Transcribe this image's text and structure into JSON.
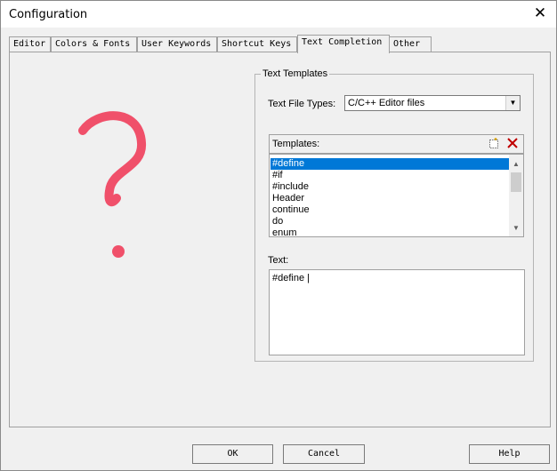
{
  "window": {
    "title": "Configuration",
    "close_glyph": "✕"
  },
  "tabs": [
    {
      "label": "Editor"
    },
    {
      "label": "Colors & Fonts"
    },
    {
      "label": "User Keywords"
    },
    {
      "label": "Shortcut Keys"
    },
    {
      "label": "Text Completion"
    },
    {
      "label": "Other"
    }
  ],
  "active_tab": "Text Completion",
  "text_templates": {
    "group_title": "Text Templates",
    "file_types_label": "Text File Types:",
    "file_types_value": "C/C++ Editor files",
    "templates_label": "Templates:",
    "templates": [
      "#define",
      "#if",
      "#include",
      "Header",
      "continue",
      "do",
      "enum"
    ],
    "selected_template": "#define",
    "text_label": "Text:",
    "text_value": "#define |"
  },
  "buttons": {
    "ok": "OK",
    "cancel": "Cancel",
    "help": "Help"
  },
  "icons": {
    "new_template": "new-document-icon",
    "delete_template": "delete-x-icon",
    "dropdown": "chevron-down-icon"
  },
  "colors": {
    "selection": "#0078d7",
    "question_mark": "#f0506a",
    "delete_x": "#c00000"
  }
}
